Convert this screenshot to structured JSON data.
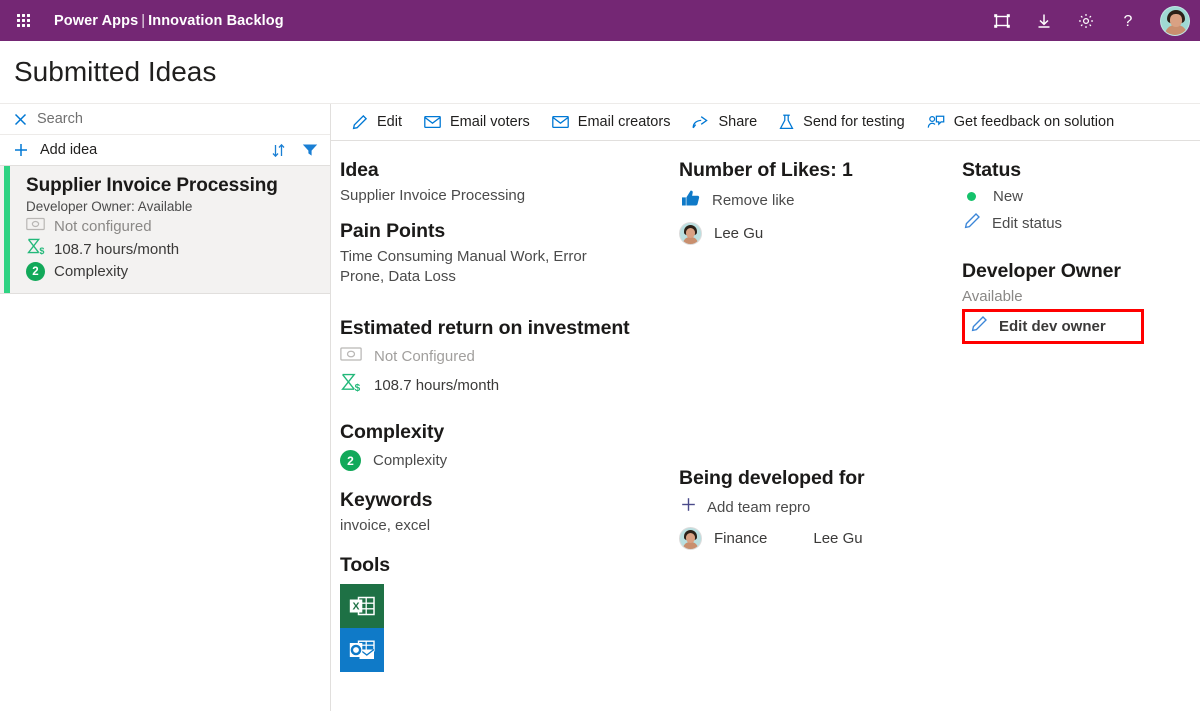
{
  "topbar": {
    "waffle_icon": "app-launcher-icon",
    "brand_app": "Power Apps",
    "brand_separator": "|",
    "brand_env": "Innovation Backlog",
    "accent_color": "#742774",
    "actions": [
      {
        "name": "fit-to-screen-icon",
        "label": "Fit to screen"
      },
      {
        "name": "download-icon",
        "label": "Download"
      },
      {
        "name": "gear-icon",
        "label": "Settings"
      },
      {
        "name": "help-icon",
        "label": "?"
      }
    ],
    "avatar_label": "Lee Gu"
  },
  "page": {
    "title": "Submitted Ideas"
  },
  "sidebar": {
    "search_placeholder": "Search",
    "search_value": "",
    "clear_icon": "close-icon",
    "add_idea_label": "Add idea",
    "add_icon": "plus-icon",
    "sort_icon": "sort-icon",
    "filter_icon": "filter-icon",
    "cards": [
      {
        "title": "Supplier Invoice Processing",
        "subtitle": "Developer Owner: Available",
        "roi_icon": "money-icon",
        "roi_label": "Not configured",
        "hours_icon": "hourglass-dollar-icon",
        "hours_label": "108.7 hours/month",
        "complexity_badge": "2",
        "complexity_label": "Complexity",
        "accent_color": "#2fd383",
        "selected": true
      }
    ]
  },
  "commandbar": {
    "items": [
      {
        "label": "Edit",
        "icon": "pencil-icon"
      },
      {
        "label": "Email voters",
        "icon": "mail-icon"
      },
      {
        "label": "Email creators",
        "icon": "mail-icon"
      },
      {
        "label": "Share",
        "icon": "share-icon"
      },
      {
        "label": "Send for testing",
        "icon": "flask-icon"
      },
      {
        "label": "Get feedback on solution",
        "icon": "feedback-person-icon"
      }
    ]
  },
  "detail": {
    "idea": {
      "heading": "Idea",
      "value": "Supplier Invoice Processing"
    },
    "pain_points": {
      "heading": "Pain Points",
      "value": "Time Consuming Manual Work, Error Prone, Data Loss"
    },
    "roi": {
      "heading": "Estimated return on investment",
      "money_icon": "money-icon",
      "money_label": "Not Configured",
      "hours_icon": "hourglass-dollar-icon",
      "hours_label": "108.7 hours/month"
    },
    "complexity": {
      "heading": "Complexity",
      "badge": "2",
      "label": "Complexity"
    },
    "keywords": {
      "heading": "Keywords",
      "value": "invoice, excel"
    },
    "tools": {
      "heading": "Tools",
      "items": [
        {
          "name": "excel-icon",
          "label": "Excel",
          "color": "#1e7145"
        },
        {
          "name": "outlook-icon",
          "label": "Outlook",
          "color": "#0f7ac8"
        }
      ]
    },
    "likes": {
      "heading": "Number of Likes: 1",
      "count": "1",
      "action_icon": "thumbs-up-icon",
      "action_label": "Remove like",
      "voters": [
        {
          "name": "Lee Gu"
        }
      ]
    },
    "developed_for": {
      "heading": "Being developed for",
      "add_icon": "plus-icon",
      "add_label": "Add team repro",
      "rows": [
        {
          "team": "Finance",
          "person": "Lee Gu"
        }
      ]
    },
    "status": {
      "heading": "Status",
      "value": "New",
      "dot_color": "#15c26b",
      "edit_icon": "pencil-icon",
      "edit_label": "Edit status"
    },
    "developer_owner": {
      "heading": "Developer Owner",
      "value": "Available",
      "edit_icon": "pencil-icon",
      "edit_label": "Edit dev owner",
      "highlight_color": "#ff0000"
    }
  }
}
